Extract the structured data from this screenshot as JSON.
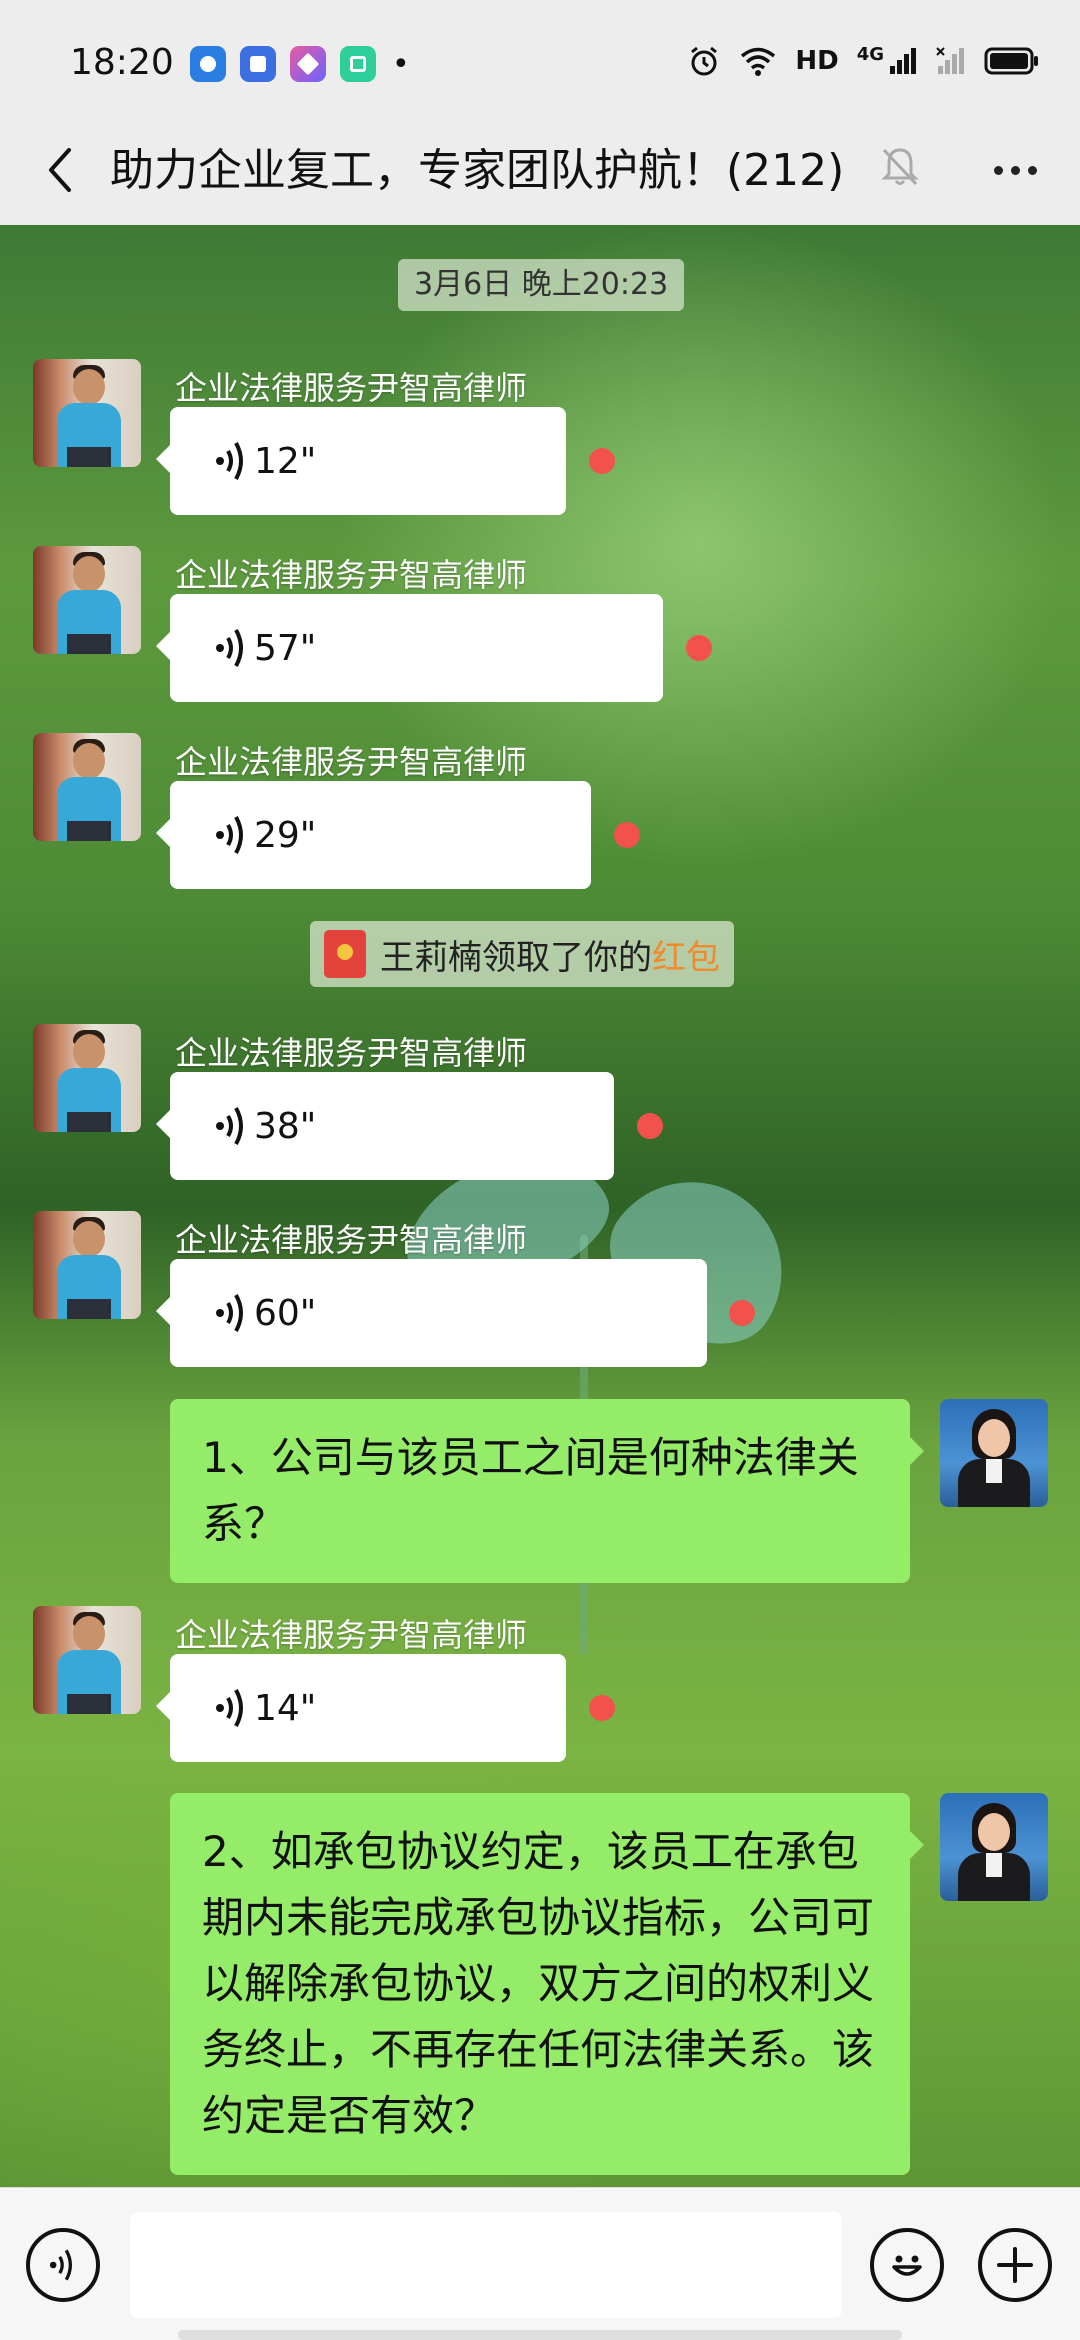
{
  "status_bar": {
    "time": "18:20",
    "apps": [
      {
        "icon": "app-icon-blue-ring",
        "color": "#2a7de1"
      },
      {
        "icon": "app-icon-blue-square",
        "color": "#3b6fe0"
      },
      {
        "icon": "app-icon-gradient-arrow",
        "color": "#8a5ce6"
      },
      {
        "icon": "app-icon-green-box",
        "color": "#2ecf9a"
      }
    ],
    "more_dot": "•",
    "hd_label": "HD",
    "network_label": "4G"
  },
  "header": {
    "title": "助力企业复工，专家团队护航！(212)"
  },
  "chat": {
    "timestamp": "3月6日 晚上20:23",
    "sender_name": "企业法律服务尹智高律师",
    "system_notice": {
      "prefix": "王莉楠领取了你的",
      "link": "红包"
    },
    "messages": [
      {
        "type": "voice",
        "duration": "12\""
      },
      {
        "type": "voice",
        "duration": "57\""
      },
      {
        "type": "voice",
        "duration": "29\""
      },
      {
        "type": "voice",
        "duration": "38\""
      },
      {
        "type": "voice",
        "duration": "60\""
      },
      {
        "type": "text",
        "text": "1、公司与该员工之间是何种法律关系？"
      },
      {
        "type": "voice",
        "duration": "14\""
      },
      {
        "type": "text",
        "text": " 2、如承包协议约定，该员工在承包期内未能完成承包协议指标，公司可以解除承包协议，双方之间的权利义务终止，不再存在任何法律关系。该约定是否有效？"
      }
    ]
  },
  "input_bar": {
    "placeholder": ""
  }
}
